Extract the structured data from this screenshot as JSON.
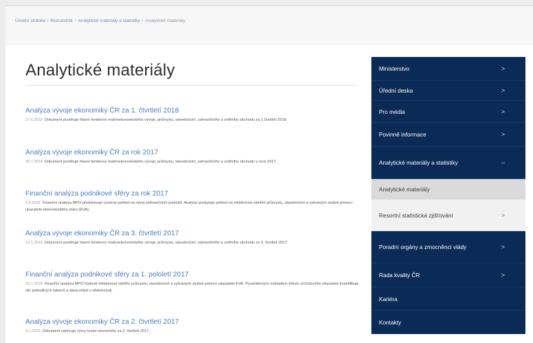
{
  "breadcrumb": {
    "items": [
      "Úvodní stránka",
      "Rozcestník",
      "Analytické materiály a statistiky"
    ],
    "current": "Analytické materiály"
  },
  "page": {
    "title": "Analytické materiály"
  },
  "articles": [
    {
      "title": "Analýza vývoje ekonomiky ČR za 1. čtvrtletí 2018",
      "date": "27.6.2018",
      "desc": "Dokument postihuje hlavní tendence makroekonomického vývoje, průmyslu, stavebnictví, zahraničního a vnitřního obchodu za 1.čtvrtletí 2018."
    },
    {
      "title": "Analýza vývoje ekonomiky ČR za rok 2017",
      "date": "30.7.2018",
      "desc": "Dokument postihuje hlavní tendence makroekonomického vývoje, průmyslu, stavebnictví, zahraničního a vnitřního obchodu v roce 2017."
    },
    {
      "title": "Finanční analýza podnikové sféry za rok 2017",
      "date": "4.5.2018",
      "desc": "Finanční analýza MPO představuje ucelený pohled na vývoj nefinančních podniků. Analýza poskytuje pohled na efektivnost odvětví průmyslu, stavebnictví a vybraných služeb pomocí ukazatele ekonomického zisku (EVA)."
    },
    {
      "title": "Analýza vývoje ekonomiky ČR za 3. čtvrtletí 2017",
      "date": "12.1.2018",
      "desc": "Dokument postihuje hlavní tendence makroekonomického vývoje, průmyslu, stavebnictví, zahraničního a vnitřního obchodu ve 3. čtvrtletí 2017."
    },
    {
      "title": "Finanční analýza podnikové sféry za 1. pololetí 2017",
      "date": "20.1.2018",
      "desc": "Finanční analýza MPO hodnotí efektivnost odvětví průmyslu, stavebnictví a vybraných služeb pomocí ukazatele EVA. Pyramidovým rozkladem tohoto vrcholového ukazatele kvantifikuje vliv jednotlivých faktorů a dává ohled o efektivnosti."
    },
    {
      "title": "Analýza vývoje ekonomiky ČR za 2. čtvrtletí 2017",
      "date": "4.1.2018",
      "desc": "Dokument zahrnuje vývoj české ekonomiky za 2. čtvrtletí 2017."
    }
  ],
  "sidebar": {
    "items": [
      {
        "label": "Ministerstvo",
        "chevron": ">"
      },
      {
        "label": "Úřední deska",
        "chevron": ">"
      },
      {
        "label": "Pro média",
        "chevron": ">"
      },
      {
        "label": "Povinně informace",
        "chevron": ">"
      },
      {
        "label": "Analytické materiály a statistiky",
        "chevron": "–"
      },
      {
        "label": "Analytické materiály",
        "chevron": ""
      },
      {
        "label": "Resortní statistická zjišťování",
        "chevron": ">"
      },
      {
        "label": "Poradní orgány a zmocněnci vlády",
        "chevron": ">"
      },
      {
        "label": "Rada kvality ČR",
        "chevron": ">"
      },
      {
        "label": "Kariéra",
        "chevron": ""
      },
      {
        "label": "Kontakty",
        "chevron": ""
      }
    ]
  }
}
